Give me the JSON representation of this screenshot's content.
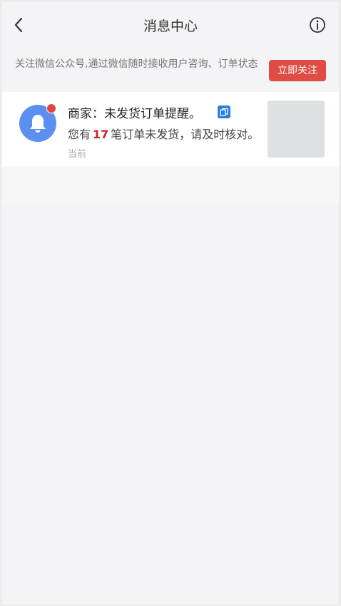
{
  "header": {
    "title": "消息中心"
  },
  "follow_bar": {
    "text": "关注微信公众号,通过微信随时接收用户咨询、订单状态",
    "button_label": "立即关注"
  },
  "messages": [
    {
      "title": "商家：未发货订单提醒。",
      "body_prefix": "您有",
      "count": "17",
      "body_suffix": "笔订单未发货，请及时核对。",
      "time": "当前",
      "unread": true
    }
  ],
  "colors": {
    "accent_red": "#e04b44",
    "avatar_blue": "#5b8ff0",
    "count_red": "#c7232a"
  }
}
